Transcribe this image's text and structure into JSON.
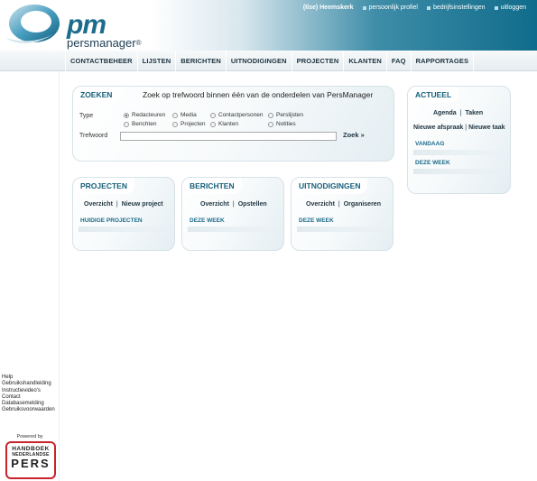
{
  "header": {
    "logo_pm": "pm",
    "logo_name": "persmanager",
    "logo_reg": "®",
    "user": "(Ilse) Heemskerk",
    "links": [
      "persoonlijk profiel",
      "bedrijfsinstellingen",
      "uitloggen"
    ]
  },
  "nav": {
    "items": [
      "CONTACTBEHEER",
      "LIJSTEN",
      "BERICHTEN",
      "UITNODIGINGEN",
      "PROJECTEN",
      "KLANTEN",
      "FAQ",
      "RAPPORTAGES"
    ]
  },
  "search": {
    "title": "ZOEKEN",
    "description": "Zoek op trefwoord binnen één van de onderdelen van PersManager",
    "type_label": "Type",
    "keyword_label": "Trefwoord",
    "keyword_value": "",
    "button": "Zoek »",
    "options": [
      {
        "label": "Redacteuren",
        "checked": true
      },
      {
        "label": "Media",
        "checked": false
      },
      {
        "label": "Contactpersonen",
        "checked": false
      },
      {
        "label": "Perslijsten",
        "checked": false
      },
      {
        "label": "Berichten",
        "checked": false
      },
      {
        "label": "Projecten",
        "checked": false
      },
      {
        "label": "Klanten",
        "checked": false
      },
      {
        "label": "Notities",
        "checked": false
      }
    ]
  },
  "actueel": {
    "title": "ACTUEEL",
    "links1": [
      "Agenda",
      "Taken"
    ],
    "links2": [
      "Nieuwe afspraak",
      "Nieuwe taak"
    ],
    "sections": [
      "VANDAAG",
      "DEZE WEEK"
    ]
  },
  "projecten": {
    "title": "PROJECTEN",
    "links": [
      "Overzicht",
      "Nieuw project"
    ],
    "section": "HUIDIGE PROJECTEN"
  },
  "berichten": {
    "title": "BERICHTEN",
    "links": [
      "Overzicht",
      "Opstellen"
    ],
    "section": "DEZE WEEK"
  },
  "uitnodigingen": {
    "title": "UITNODIGINGEN",
    "links": [
      "Overzicht",
      "Organiseren"
    ],
    "section": "DEZE WEEK"
  },
  "sidebar": {
    "links": [
      "Help",
      "Gebruikshandleiding",
      "Instructievideo's",
      "Contact",
      "Databasemelding",
      "Gebruiksvoorwaarden"
    ],
    "powered": "Powered by",
    "badge": [
      "HANDBOEK",
      "NEDERLANDSE",
      "PERS"
    ]
  },
  "colors": {
    "accent": "#155f7a",
    "header_dark": "#0f6c8b",
    "badge_red": "#c8232c"
  }
}
